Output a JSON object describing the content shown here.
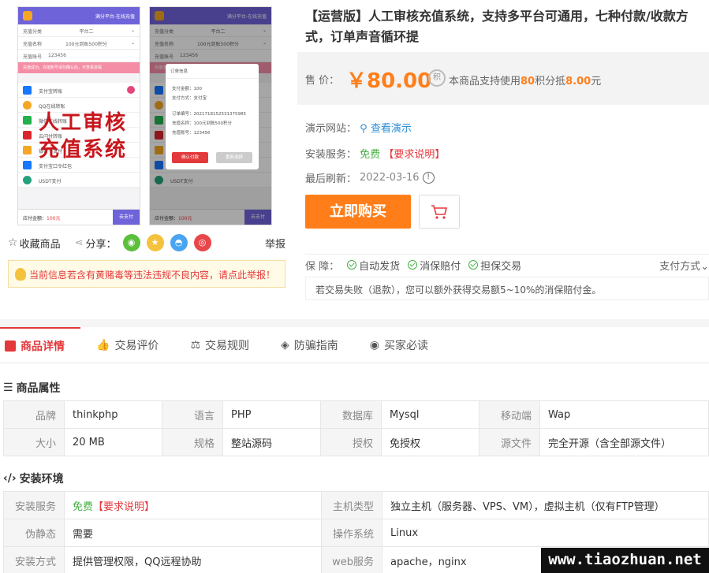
{
  "product": {
    "title": "【运营版】人工审核充值系统，支持多平台可通用，七种付款/收款方式，订单声音循环提",
    "price_label": "售 价：",
    "price": "￥80.00",
    "points_text_pre": "本商品支持使用",
    "points_value": "80",
    "points_text_mid": "积分抵",
    "points_money": "8.00",
    "points_text_post": "元",
    "demo_label": "演示网站：",
    "demo_link": "查看演示",
    "install_label": "安装服务：",
    "install_value": "免费",
    "install_note": "【要求说明】",
    "refresh_label": "最后刷新：",
    "refresh_date": "2022-03-16",
    "buy_now": "立即购买"
  },
  "image": {
    "overlay_line1": "人工审核",
    "overlay_line2": "充值系统",
    "phone_header": "满分平台-在线充值",
    "recharge_type_label": "充值分类",
    "recharge_type_value": "平台二",
    "recharge_name_label": "充值名称",
    "recharge_name_value": "100元到账500积分",
    "recharge_acct_label": "充值账号",
    "recharge_acct_value": "123456",
    "pink_notice": "充值成功，充值账号请勿确认后，可查看进程",
    "pay_methods": [
      "支付宝转账",
      "QQ在线转账",
      "微信在线转账",
      "云闪付转账",
      "银行卡支付",
      "支付宝口令红包",
      "USDT支付"
    ],
    "footer_total": "应付金额：",
    "footer_amount": "100元",
    "footer_btn": "去支付",
    "modal_title": "订单信息",
    "modal_amount": "支付金额：100",
    "modal_method": "支付方式：支付宝",
    "modal_order": "订单编号：2021718152531375985",
    "modal_name": "充值名称：100元到账500积分",
    "modal_acct": "充值账号：123456",
    "modal_confirm": "确认付款",
    "modal_cancel": "重新选择"
  },
  "actions": {
    "favorite": "收藏商品",
    "share": "分享：",
    "report": "举报"
  },
  "notice": "当前信息若含有黄赌毒等违法违规不良内容，请点此举报！",
  "guarantee": {
    "label": "保 障：",
    "items": [
      "自动发货",
      "消保赔付",
      "担保交易"
    ],
    "pay_methods": "支付方式",
    "desc": "若交易失败（退款），您可以额外获得交易额5~10%的消保赔付金。"
  },
  "tabs": [
    "商品详情",
    "交易评价",
    "交易规则",
    "防骗指南",
    "买家必读"
  ],
  "attributes": {
    "title": "商品属性",
    "rows": [
      [
        [
          "品牌",
          "thinkphp"
        ],
        [
          "语言",
          "PHP"
        ],
        [
          "数据库",
          "Mysql"
        ],
        [
          "移动端",
          "Wap"
        ]
      ],
      [
        [
          "大小",
          "20 MB"
        ],
        [
          "规格",
          "整站源码"
        ],
        [
          "授权",
          "免授权"
        ],
        [
          "源文件",
          "完全开源（含全部源文件）"
        ]
      ]
    ]
  },
  "environment": {
    "title": "安装环境",
    "install_key": "安装服务",
    "install_free": "免费",
    "install_note": "【要求说明】",
    "host_key": "主机类型",
    "host_value": "独立主机（服务器、VPS、VM），虚拟主机（仅有FTP管理）",
    "pseudo_key": "伪静态",
    "pseudo_value": "需要",
    "os_key": "操作系统",
    "os_value": "Linux",
    "method_key": "安装方式",
    "method_value": "提供管理权限，QQ远程协助",
    "web_key": "web服务",
    "web_value": "apache，nginx"
  },
  "watermark": "www.tiaozhuan.net",
  "colors": {
    "accent": "#e4393c",
    "buy": "#ff7e1a",
    "price": "#ff7e1a",
    "phone_bar": "#6f63d9",
    "free": "#46b044"
  }
}
